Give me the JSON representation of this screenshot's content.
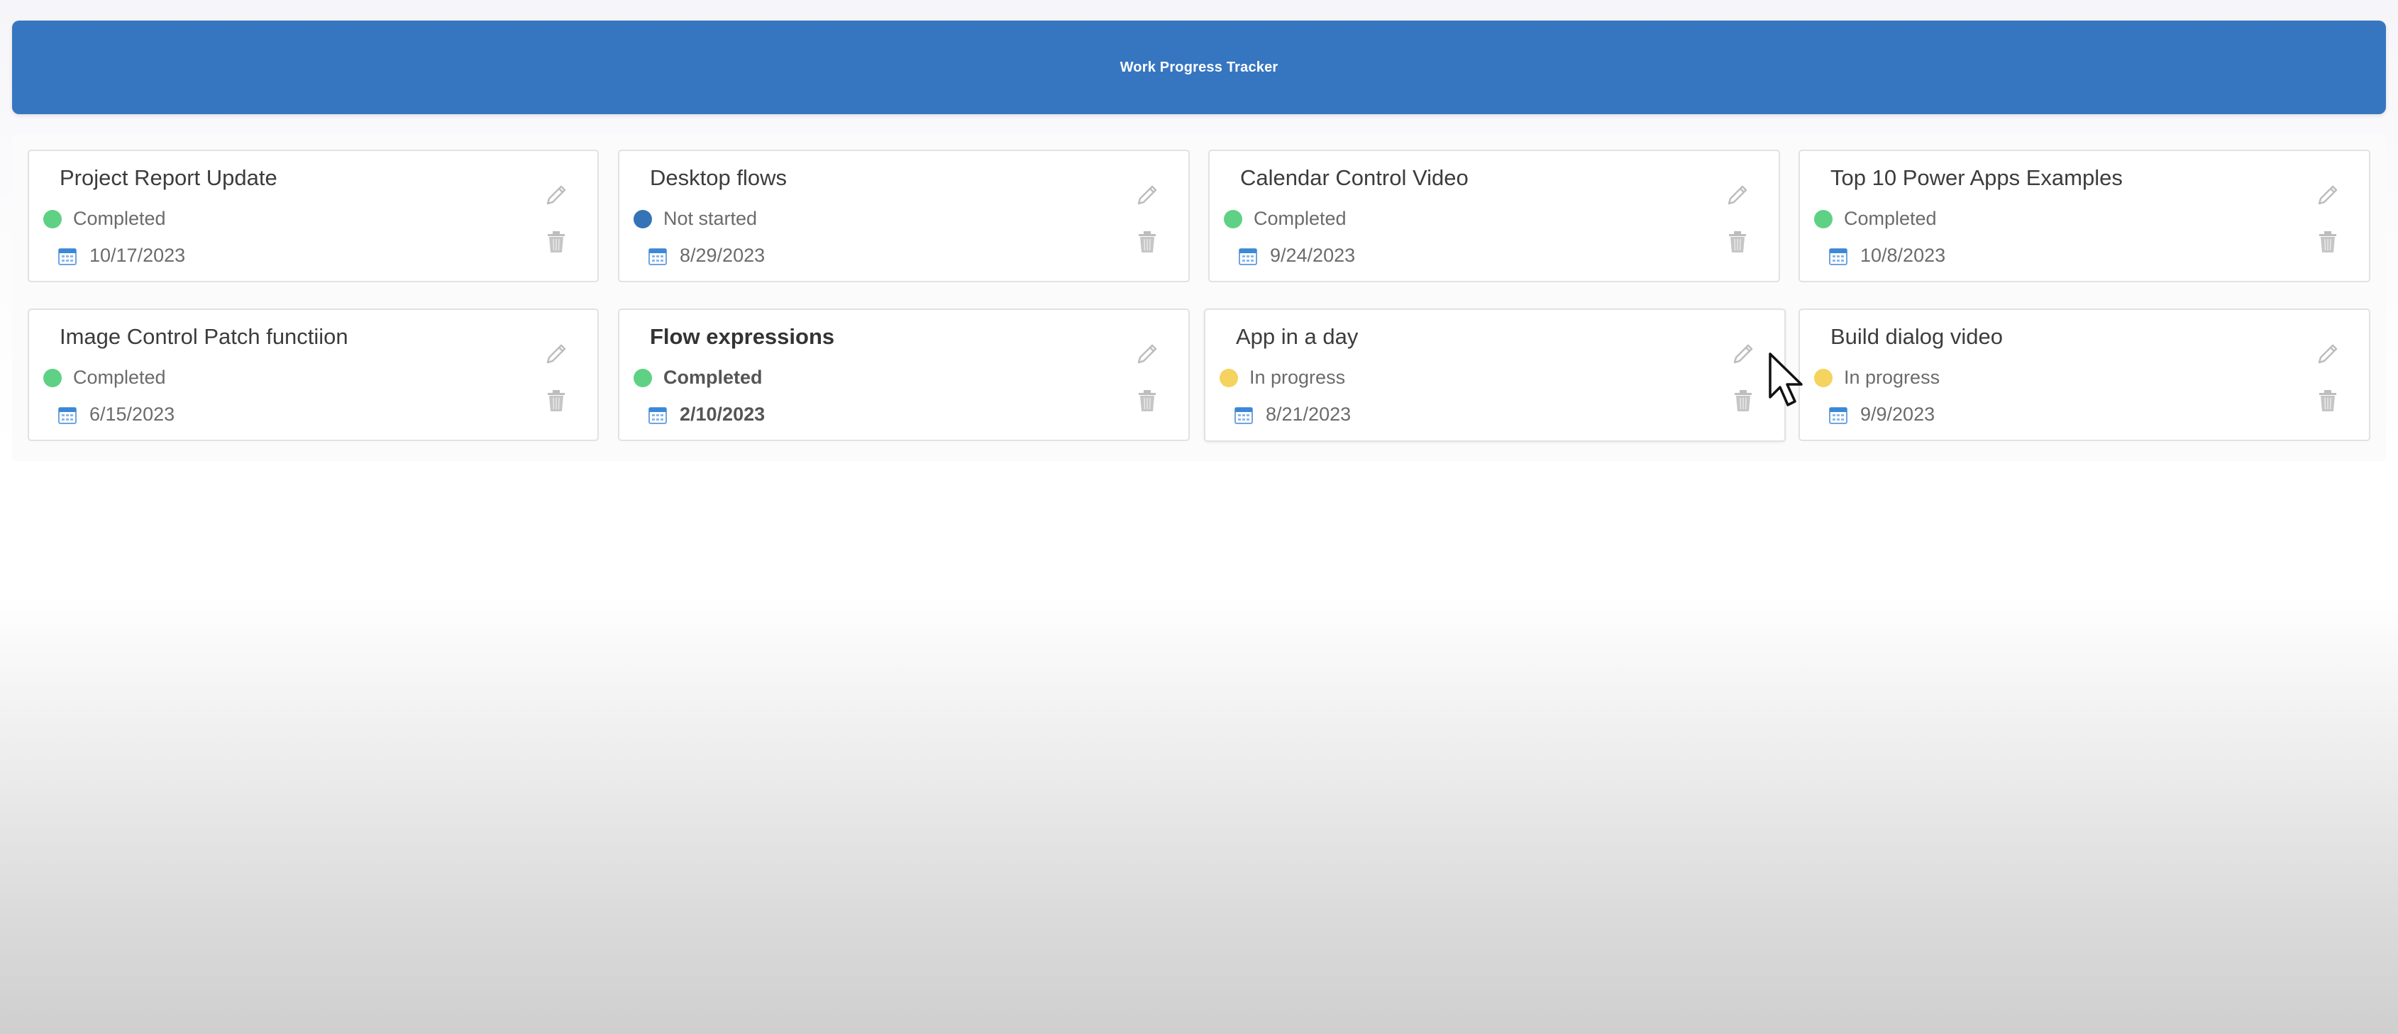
{
  "header": {
    "title": "Work Progress Tracker"
  },
  "colors": {
    "header_bg": "#3676c0",
    "completed": "#5fd184",
    "not_started": "#3473b6",
    "in_progress": "#f4d35e"
  },
  "cards": [
    {
      "title": "Project Report Update",
      "status": "Completed",
      "status_color": "#5fd184",
      "date": "10/17/2023"
    },
    {
      "title": "Desktop flows",
      "status": "Not started",
      "status_color": "#3473b6",
      "date": "8/29/2023"
    },
    {
      "title": "Calendar Control Video",
      "status": "Completed",
      "status_color": "#5fd184",
      "date": "9/24/2023"
    },
    {
      "title": "Top 10 Power Apps Examples",
      "status": "Completed",
      "status_color": "#5fd184",
      "date": "10/8/2023"
    },
    {
      "title": "Image Control Patch functiion",
      "status": "Completed",
      "status_color": "#5fd184",
      "date": "6/15/2023"
    },
    {
      "title": "Flow expressions",
      "status": "Completed",
      "status_color": "#5fd184",
      "date": "2/10/2023"
    },
    {
      "title": "App in a day",
      "status": "In progress",
      "status_color": "#f4d35e",
      "date": "8/21/2023"
    },
    {
      "title": "Build dialog video",
      "status": "In progress",
      "status_color": "#f4d35e",
      "date": "9/9/2023"
    }
  ],
  "icons": {
    "edit": "pencil-icon",
    "delete": "trash-icon",
    "date": "calendar-icon",
    "pointer": "mouse-cursor-icon"
  }
}
